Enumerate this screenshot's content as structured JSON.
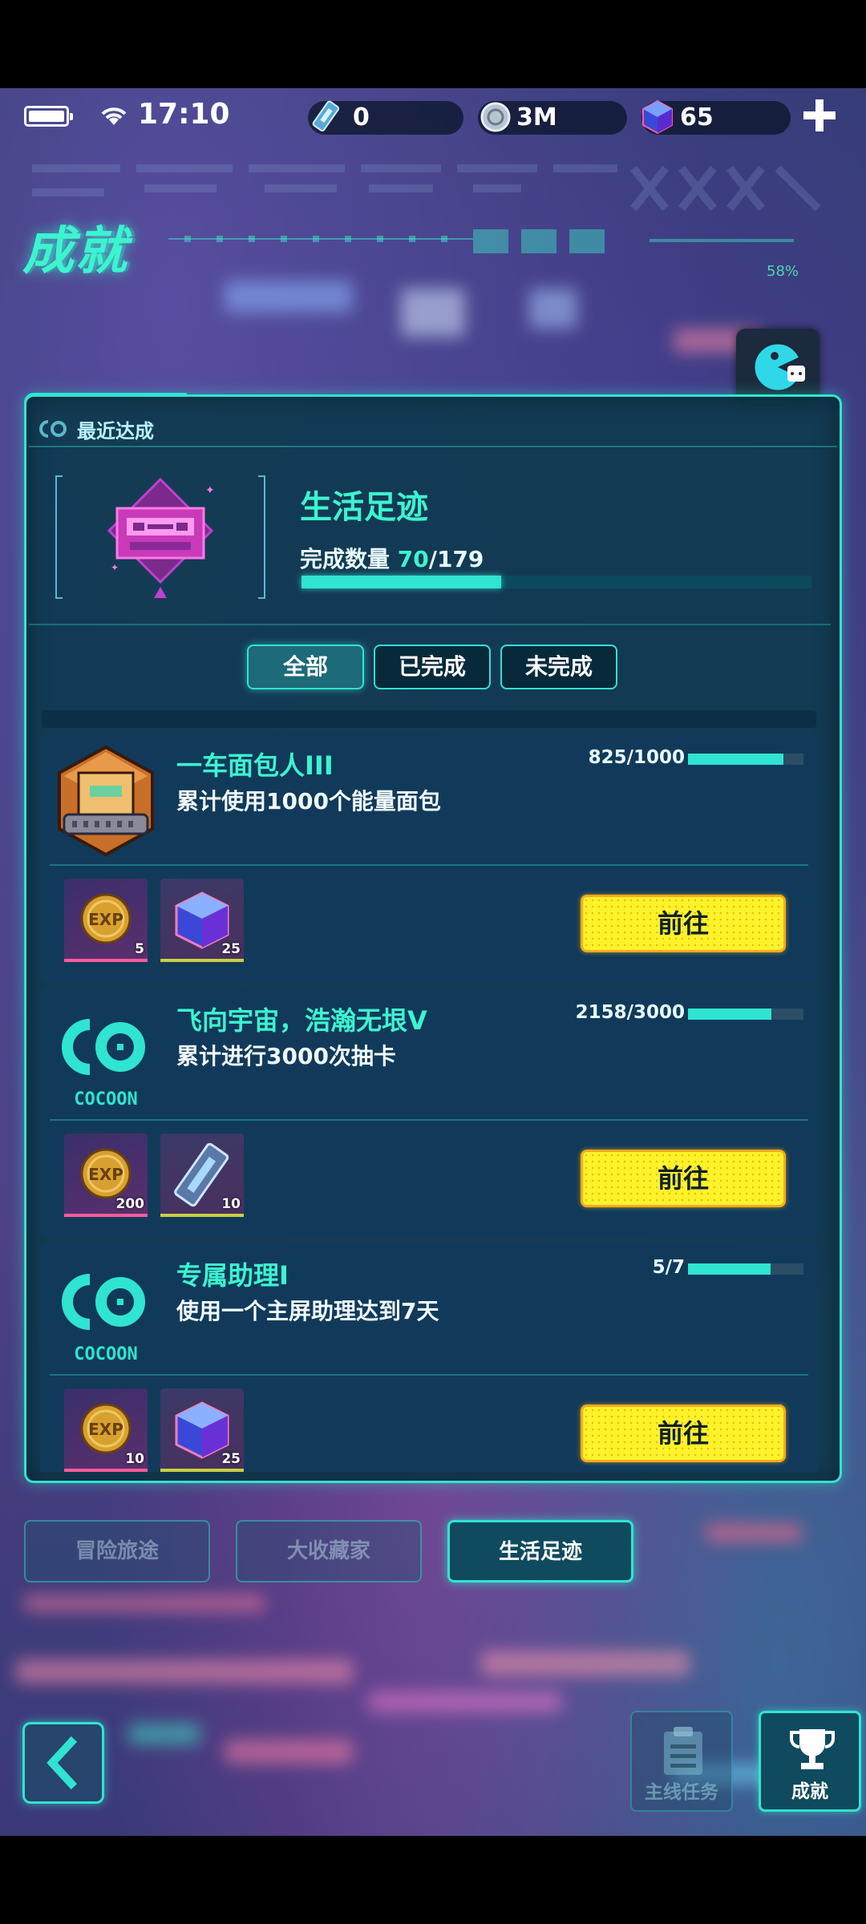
{
  "status_bar": {
    "time": "17:10"
  },
  "resources": [
    {
      "icon": "ticket-icon",
      "value": "0"
    },
    {
      "icon": "coin-icon",
      "value": "3M"
    },
    {
      "icon": "gem-icon",
      "value": "65"
    }
  ],
  "header": {
    "title": "成就",
    "deco_percent": "58%"
  },
  "panel": {
    "recent_label": "最近达成",
    "category_title": "生活足迹",
    "count_label": "完成数量",
    "count_current": "70",
    "count_total": "/179",
    "progress_fraction": 0.391
  },
  "filters": [
    {
      "label": "全部",
      "active": true
    },
    {
      "label": "已完成",
      "active": false
    },
    {
      "label": "未完成",
      "active": false
    }
  ],
  "achievements": [
    {
      "title": "一车面包人III",
      "desc": "累计使用1000个能量面包",
      "progress_text": "825/1000",
      "progress_fraction": 0.825,
      "icon": "bread-badge-icon",
      "rewards": [
        {
          "icon": "exp-coin-icon",
          "qty": "5"
        },
        {
          "icon": "gem-cube-icon",
          "qty": "25"
        }
      ],
      "button": "前往"
    },
    {
      "title": "飞向宇宙，浩瀚无垠V",
      "desc": "累计进行3000次抽卡",
      "progress_text": "2158/3000",
      "progress_fraction": 0.719,
      "icon": "cocoon-logo-icon",
      "icon_text": "COCOON",
      "rewards": [
        {
          "icon": "exp-coin-icon",
          "qty": "200"
        },
        {
          "icon": "ticket-icon",
          "qty": "10"
        }
      ],
      "button": "前往"
    },
    {
      "title": "专属助理I",
      "desc": "使用一个主屏助理达到7天",
      "progress_text": "5/7",
      "progress_fraction": 0.714,
      "icon": "cocoon-logo-icon",
      "icon_text": "COCOON",
      "rewards": [
        {
          "icon": "exp-coin-icon",
          "qty": "10"
        },
        {
          "icon": "gem-cube-icon",
          "qty": "25"
        }
      ],
      "button": "前往"
    }
  ],
  "category_tabs": [
    {
      "label": "冒险旅途",
      "active": false
    },
    {
      "label": "大收藏家",
      "active": false
    },
    {
      "label": "生活足迹",
      "active": true
    }
  ],
  "bottom_nav": [
    {
      "label": "主线任务",
      "icon": "clipboard-icon",
      "active": false
    },
    {
      "label": "成就",
      "icon": "trophy-icon",
      "active": true
    }
  ],
  "colors": {
    "accent": "#2fe4d0",
    "button": "#fff22a",
    "panel": "#0e3a4e"
  }
}
